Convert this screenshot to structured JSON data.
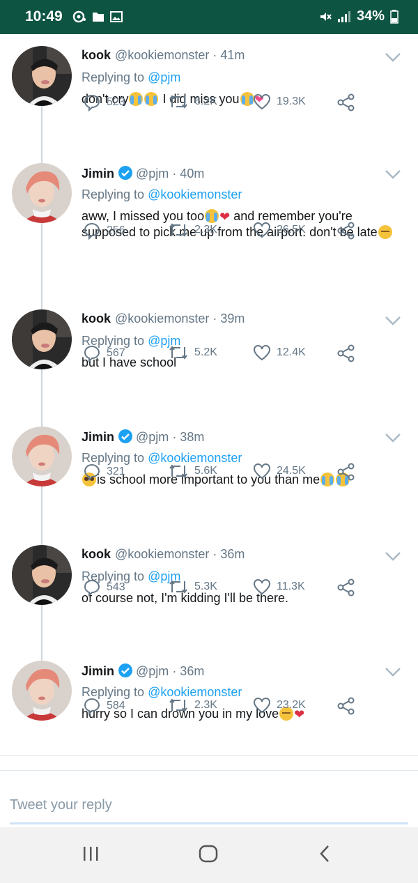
{
  "status": {
    "time": "10:49",
    "battery": "34%"
  },
  "tweets": [
    {
      "name": "kook",
      "handle": "@kookiemonster",
      "time": "· 41m",
      "replying_label": "Replying to",
      "replying_to": "@pjm",
      "verified": false,
      "text": "don't cry",
      "text2": " I did miss you",
      "text3": "",
      "replies": "523",
      "retweets": "6.2K",
      "likes": "19.3K"
    },
    {
      "name": "Jimin",
      "handle": "@pjm",
      "time": "· 40m",
      "replying_label": "Replying to",
      "replying_to": "@kookiemonster",
      "verified": true,
      "text": "aww, I missed you too",
      "text2": " and remember you're supposed to pick me up from the airport. don't be late",
      "text3": "",
      "replies": "256",
      "retweets": "2.3K",
      "likes": "26.5K"
    },
    {
      "name": "kook",
      "handle": "@kookiemonster",
      "time": "· 39m",
      "replying_label": "Replying to",
      "replying_to": "@pjm",
      "verified": false,
      "text": "but I have school",
      "text2": "",
      "text3": "",
      "replies": "567",
      "retweets": "5.2K",
      "likes": "12.4K"
    },
    {
      "name": "Jimin",
      "handle": "@pjm",
      "time": "· 38m",
      "replying_label": "Replying to",
      "replying_to": "@kookiemonster",
      "verified": true,
      "text": "",
      "text2": "is school more important to you than me",
      "text3": "",
      "replies": "321",
      "retweets": "5.6K",
      "likes": "24.5K"
    },
    {
      "name": "kook",
      "handle": "@kookiemonster",
      "time": "· 36m",
      "replying_label": "Replying to",
      "replying_to": "@pjm",
      "verified": false,
      "text": "of course not, I'm kidding I'll be there.",
      "text2": "",
      "text3": "",
      "replies": "543",
      "retweets": "5.3K",
      "likes": "11.3K"
    },
    {
      "name": "Jimin",
      "handle": "@pjm",
      "time": "· 36m",
      "replying_label": "Replying to",
      "replying_to": "@kookiemonster",
      "verified": true,
      "text": "hurry so I can drown you in my love",
      "text2": "",
      "text3": "",
      "replies": "584",
      "retweets": "2.3K",
      "likes": "23.2K"
    }
  ],
  "reply": {
    "placeholder": "Tweet your reply"
  },
  "icons": {
    "reply": "reply-icon",
    "retweet": "retweet-icon",
    "like": "heart-icon",
    "share": "share-icon",
    "menu": "chevron-down-icon",
    "verified": "verified-badge-icon",
    "nav_recent": "recent-apps-icon",
    "nav_home": "home-icon",
    "nav_back": "back-icon"
  },
  "colors": {
    "statusbar": "#0d5442",
    "link": "#1da1f2",
    "muted": "#657786"
  }
}
